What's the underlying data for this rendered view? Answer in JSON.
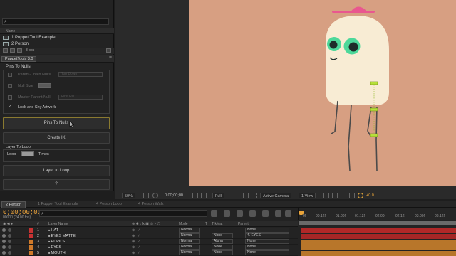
{
  "project": {
    "search_icon": "magnifier-icon",
    "search_glyph": "⌕",
    "name_header": "Name",
    "items": [
      {
        "name": "1 Puppet Tool Example"
      },
      {
        "name": "2 Person"
      }
    ],
    "bpc": "8 bpc"
  },
  "puppettools": {
    "tab_label": "PuppetTools 3.0",
    "menu_glyph": "≡",
    "pins_to_nulls_title": "Pins To Nulls",
    "parent_chain_label": "Parent-Chain Nulls",
    "parent_chain_value": "Top Down",
    "null_size_label": "Null Size",
    "master_parent_label": "Master Parent Null",
    "master_parent_value": "First Pin",
    "lock_shy_label": "Lock and Shy Artwork",
    "lock_shy_checked": true,
    "checkmark": "✓",
    "pins_to_nulls_button": "Pins To Nulls",
    "create_ik_button": "Create IK",
    "layer_to_loop_title": "Layer To Loop",
    "loop_label": "Loop",
    "times_label": "Times",
    "layer_to_loop_button": "Layer to Loop",
    "help_button": "?"
  },
  "viewer": {
    "zoom": "50%",
    "timecode": "0;00;00;00",
    "resolution": "Full",
    "camera": "Active Camera",
    "views": "1 View",
    "exposure": "+0.0",
    "canvas_color": "#d79f82"
  },
  "timeline": {
    "tabs": [
      "2 Person",
      "1 Puppet Tool Example",
      "4 Person Loop",
      "4 Person Walk"
    ],
    "timecode": "0;00;00;00",
    "fps": "00000 (24.00 fps)",
    "search_glyph": "⌕",
    "ruler_ticks": [
      "0f",
      "00:12f",
      "01:00f",
      "01:12f",
      "02:00f",
      "02:12f",
      "03:00f",
      "03:12f"
    ],
    "headers": {
      "layer_name": "Layer Name",
      "switches": "⊕ ✱ \\ fx ▣ ◎ ◔ ⬡",
      "mode": "Mode",
      "t": "T",
      "trkmat": "TrkMat",
      "parent": "Parent"
    },
    "layers": [
      {
        "num": "1",
        "name": "HAT",
        "color": "#c83232",
        "mode": "Normal",
        "trkmat": "",
        "parent": "None",
        "bar": "#b02828"
      },
      {
        "num": "2",
        "name": "EYES MATTE",
        "color": "#c83232",
        "mode": "Normal",
        "trkmat": "None",
        "parent": "4. EYES",
        "bar": "#a52626"
      },
      {
        "num": "3",
        "name": "PUPILS",
        "color": "#d07a2a",
        "mode": "Normal",
        "trkmat": "Alpha",
        "parent": "None",
        "bar": "#b8762a"
      },
      {
        "num": "4",
        "name": "EYES",
        "color": "#d07a2a",
        "mode": "Normal",
        "trkmat": "None",
        "parent": "None",
        "bar": "#b8762a"
      },
      {
        "num": "5",
        "name": "MOUTH",
        "color": "#d07a2a",
        "mode": "Normal",
        "trkmat": "None",
        "parent": "None",
        "bar": "#b8762a"
      }
    ]
  }
}
